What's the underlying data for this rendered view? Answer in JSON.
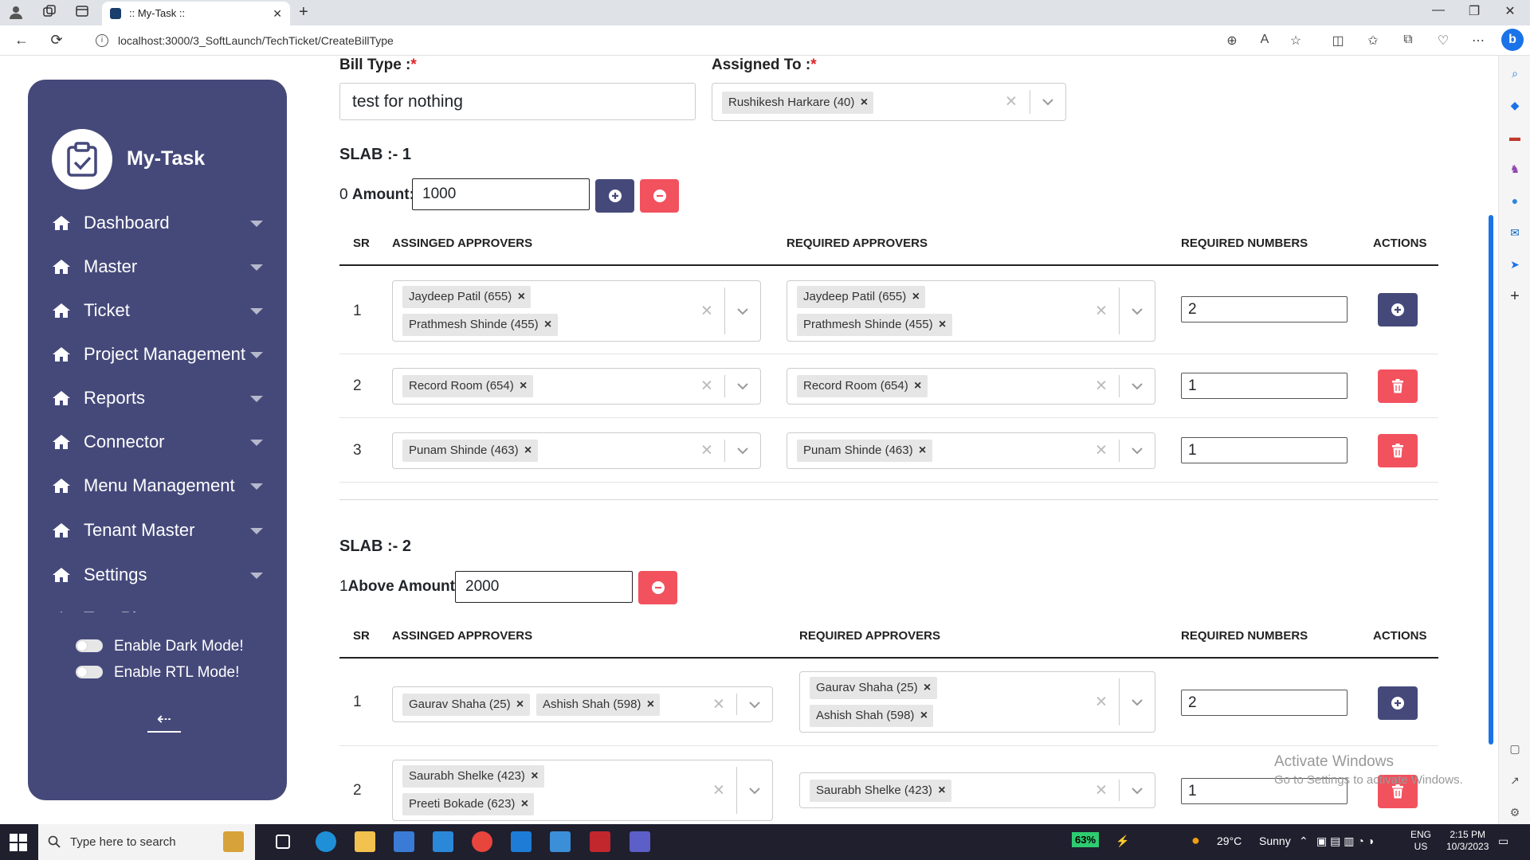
{
  "browser": {
    "tab_title": ":: My-Task ::",
    "url": "localhost:3000/3_SoftLaunch/TechTicket/CreateBillType"
  },
  "sidebar": {
    "brand": "My-Task",
    "items": [
      {
        "label": "Dashboard"
      },
      {
        "label": "Master"
      },
      {
        "label": "Ticket"
      },
      {
        "label": "Project Management"
      },
      {
        "label": "Reports"
      },
      {
        "label": "Connector"
      },
      {
        "label": "Menu Management"
      },
      {
        "label": "Tenant Master"
      },
      {
        "label": "Settings"
      },
      {
        "label": "Test Ph..."
      }
    ],
    "dark_mode_label": "Enable Dark Mode!",
    "rtl_mode_label": "Enable RTL Mode!",
    "dark_mode_on": false,
    "rtl_mode_on": false
  },
  "form": {
    "bill_type_label": "Bill Type :",
    "required_mark": "*",
    "bill_type_value": "test for nothing",
    "assigned_to_label": "Assigned To :",
    "assigned_to_chip": "Rushikesh Harkare (40)"
  },
  "table_headers": {
    "sr": "SR",
    "assigned": "ASSINGED APPROVERS",
    "required": "REQUIRED APPROVERS",
    "numbers": "REQUIRED NUMBERS",
    "actions": "ACTIONS"
  },
  "slab1": {
    "title": "SLAB :- 1",
    "amount_prefix": "0",
    "amount_label": "Amount:",
    "amount_value": "1000",
    "rows": [
      {
        "sr": "1",
        "assigned": [
          "Jaydeep Patil (655)",
          "Prathmesh Shinde (455)"
        ],
        "required": [
          "Jaydeep Patil (655)",
          "Prathmesh Shinde (455)"
        ],
        "number": "2",
        "action": "add"
      },
      {
        "sr": "2",
        "assigned": [
          "Record Room (654)"
        ],
        "required": [
          "Record Room (654)"
        ],
        "number": "1",
        "action": "delete"
      },
      {
        "sr": "3",
        "assigned": [
          "Punam Shinde (463)"
        ],
        "required": [
          "Punam Shinde (463)"
        ],
        "number": "1",
        "action": "delete"
      }
    ]
  },
  "slab2": {
    "title": "SLAB :- 2",
    "amount_prefix": "1",
    "amount_label": "Above Amount:",
    "amount_value": "2000",
    "rows": [
      {
        "sr": "1",
        "assigned": [
          "Gaurav Shaha (25)",
          "Ashish Shah (598)"
        ],
        "required": [
          "Gaurav Shaha (25)",
          "Ashish Shah (598)"
        ],
        "number": "2",
        "action": "add"
      },
      {
        "sr": "2",
        "assigned": [
          "Saurabh Shelke (423)",
          "Preeti Bokade (623)"
        ],
        "required": [
          "Saurabh Shelke (423)"
        ],
        "number": "1",
        "action": "delete"
      }
    ]
  },
  "watermark": {
    "line1": "Activate Windows",
    "line2": "Go to Settings to activate Windows."
  },
  "taskbar": {
    "search_placeholder": "Type here to search",
    "battery": "63%",
    "weather_temp": "29°C",
    "weather_desc": "Sunny",
    "lang1": "ENG",
    "lang2": "US",
    "time": "2:15 PM",
    "date": "10/3/2023"
  },
  "colors": {
    "sidebar_bg": "#45497a",
    "primary_button": "#45497a",
    "danger_button": "#f1525e",
    "required_mark": "#e02424"
  }
}
